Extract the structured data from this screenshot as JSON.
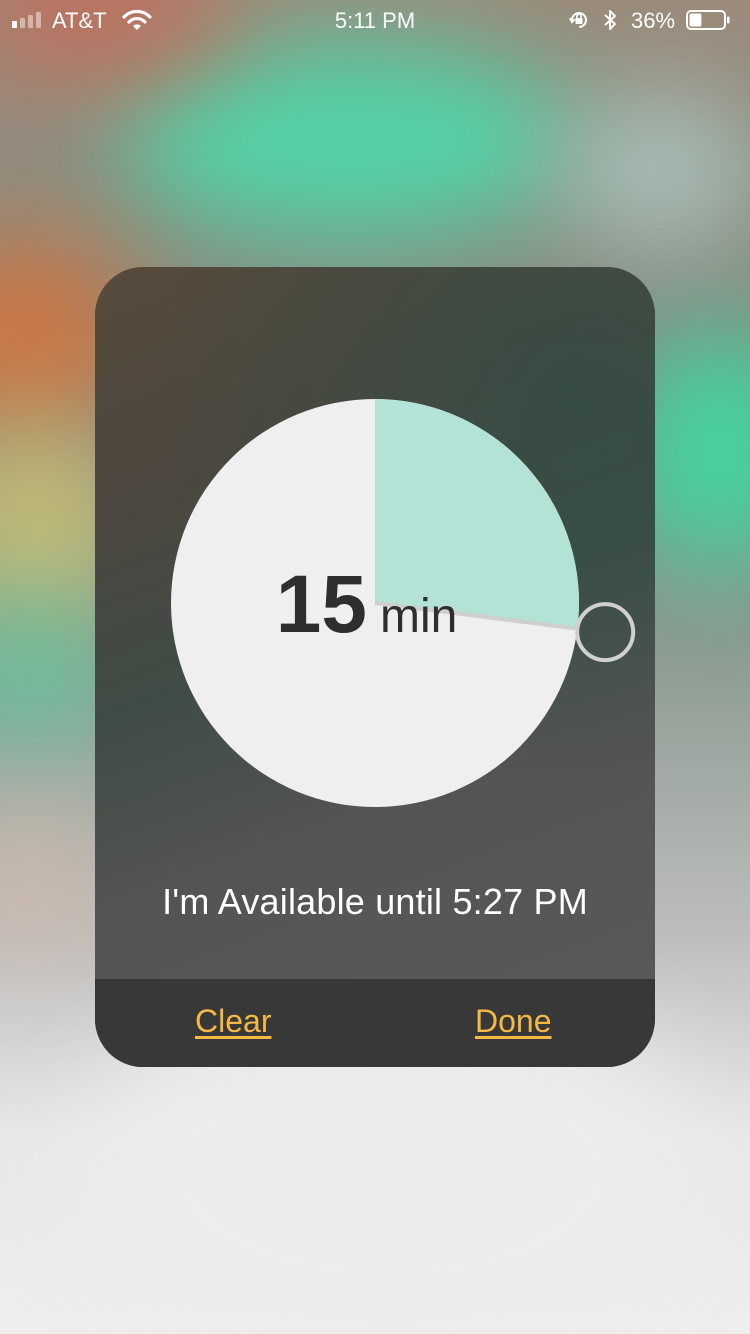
{
  "status_bar": {
    "carrier": "AT&T",
    "time": "5:11 PM",
    "battery_percent": "36%",
    "battery_level": 0.36,
    "signal_bars": 1,
    "icons": [
      "signal-icon",
      "wifi-icon",
      "orientation-lock-icon",
      "bluetooth-icon",
      "battery-icon"
    ]
  },
  "timer": {
    "value": "15",
    "unit": "min",
    "fraction": 0.27,
    "colors": {
      "dial": "#efefef",
      "elapsed": "#b2e3d6",
      "handle": "#d0d0d0"
    }
  },
  "status_message": "I'm Available until 5:27 PM",
  "actions": {
    "clear_label": "Clear",
    "done_label": "Done",
    "accent": "#f5b843"
  }
}
